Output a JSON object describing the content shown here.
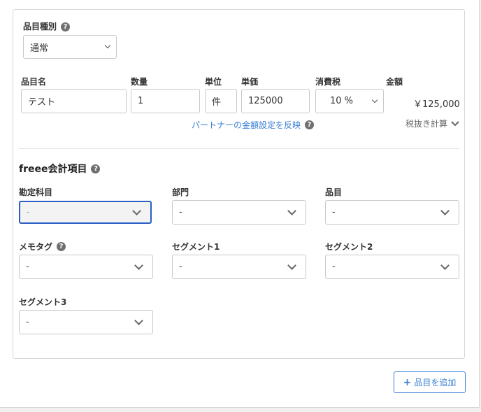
{
  "item_type": {
    "label": "品目種別",
    "value": "通常"
  },
  "line": {
    "headers": {
      "name": "品目名",
      "quantity": "数量",
      "unit": "単位",
      "unit_price": "単価",
      "tax": "消費税",
      "amount": "金額"
    },
    "name": "テスト",
    "quantity": "1",
    "unit": "件",
    "unit_price": "125000",
    "tax": "10 %",
    "amount": "￥125,000"
  },
  "partner_link": "パートナーの金額設定を反映",
  "tax_calc": "税抜き計算",
  "freee": {
    "title": "freee会計項目",
    "fields": [
      {
        "label": "勘定科目",
        "value": "-"
      },
      {
        "label": "部門",
        "value": "-"
      },
      {
        "label": "品目",
        "value": "-"
      },
      {
        "label": "メモタグ",
        "value": "-"
      },
      {
        "label": "セグメント1",
        "value": "-"
      },
      {
        "label": "セグメント2",
        "value": "-"
      },
      {
        "label": "セグメント3",
        "value": "-"
      }
    ]
  },
  "add_button": "品目を追加",
  "icons": {
    "help": "help-circle-icon",
    "chevron": "chevron-down-icon",
    "plus": "plus-icon"
  },
  "colors": {
    "link": "#3a7fd5",
    "focus": "#2c5fc4"
  }
}
